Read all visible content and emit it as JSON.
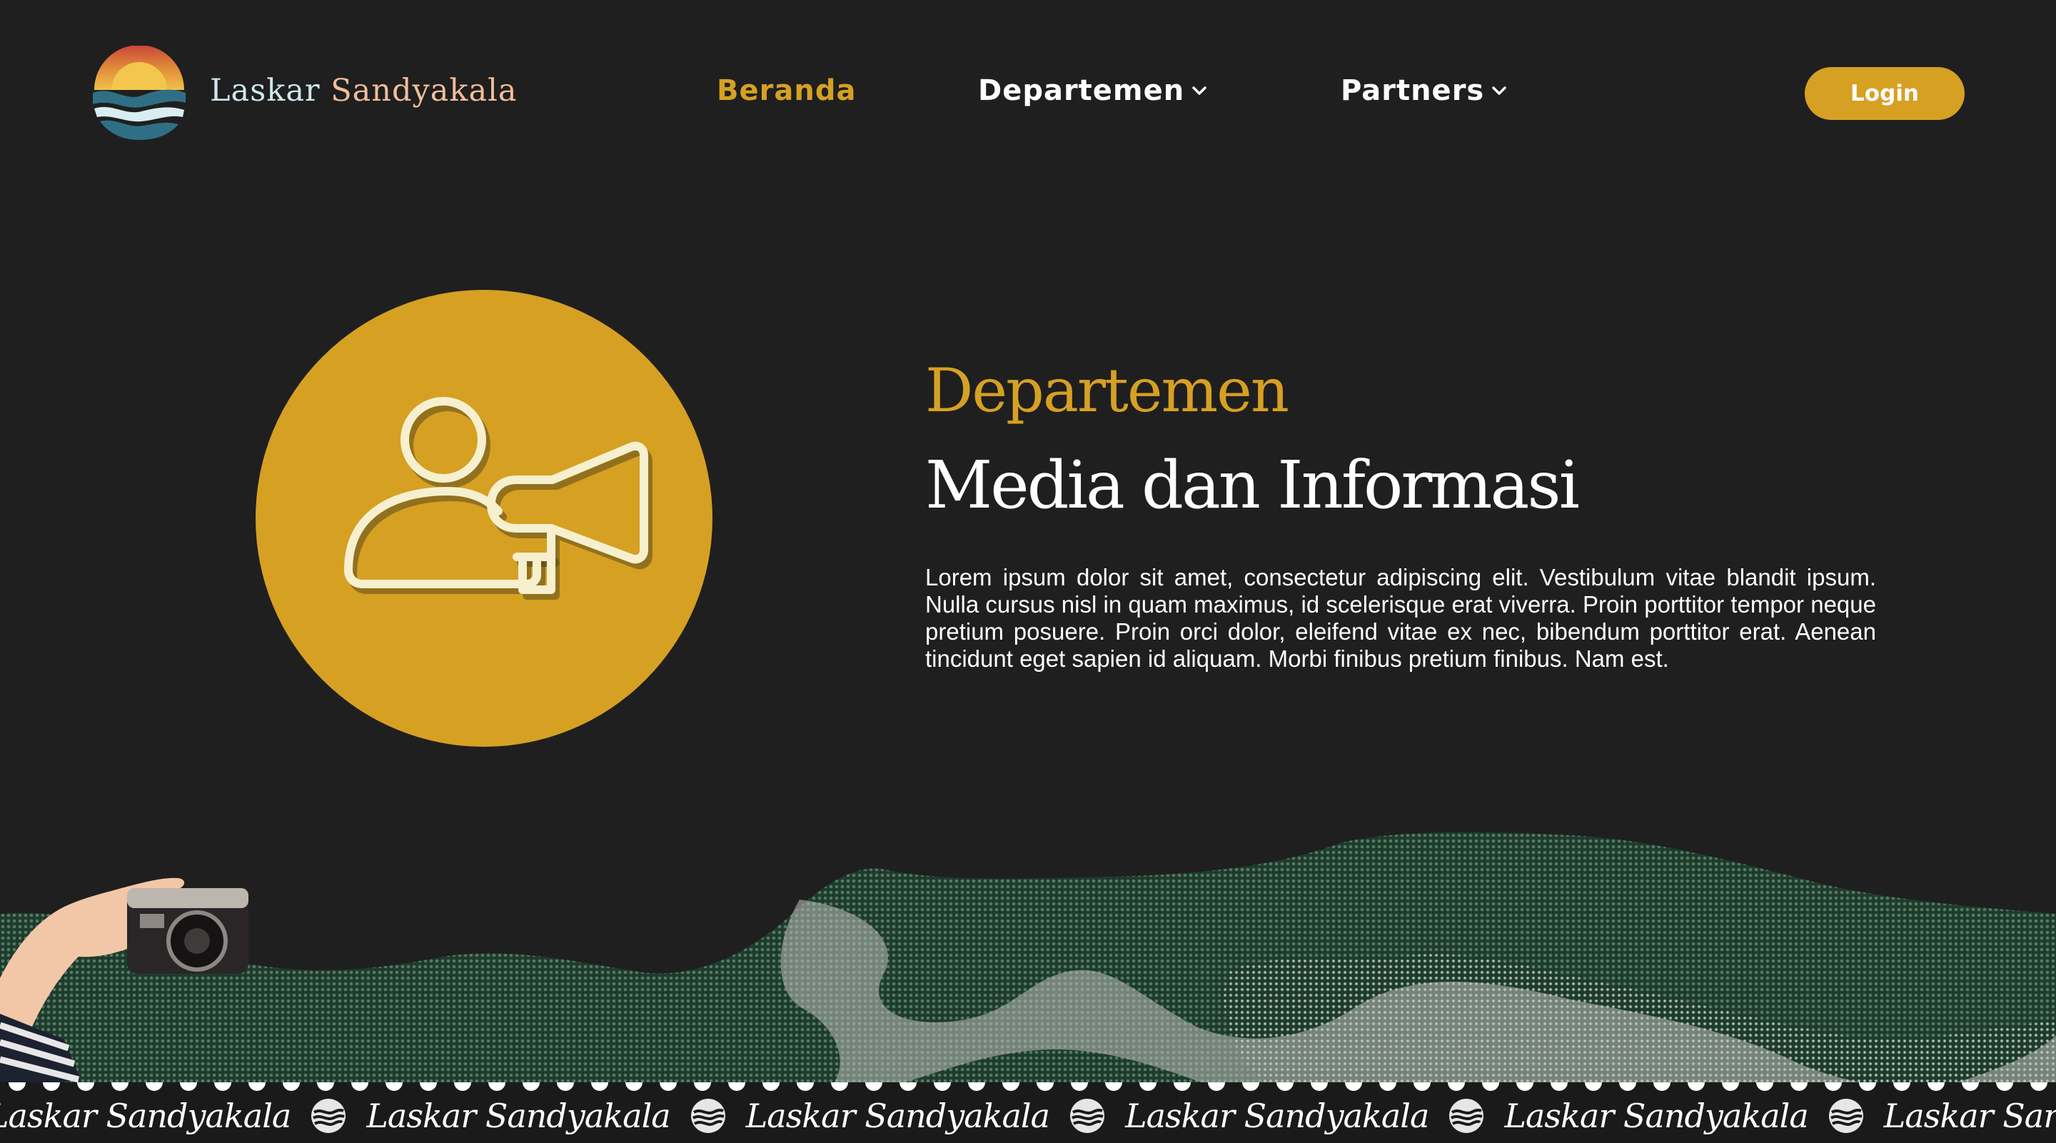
{
  "brand": {
    "name_part1": "Laskar",
    "name_part2": "Sandyakala"
  },
  "nav": {
    "items": [
      {
        "label": "Beranda",
        "active": true
      },
      {
        "label": "Departemen",
        "has_dropdown": true
      },
      {
        "label": "Partners",
        "has_dropdown": true
      }
    ],
    "login_label": "Login"
  },
  "hero": {
    "kicker": "Departemen",
    "title": "Media dan Informasi",
    "description": "Lorem ipsum dolor sit amet, consectetur adipiscing elit. Vestibulum vitae blandit ipsum. Nulla cursus nisl in quam maximus, id scelerisque erat viverra. Proin porttitor tempor neque pretium posuere. Proin orci dolor, eleifend vitae ex nec, bibendum porttitor erat. Aenean tincidunt eget sapien id aliquam. Morbi finibus pretium finibus. Nam est.",
    "icon": "user-megaphone-icon"
  },
  "ticker": {
    "text": "Laskar Sandyakala"
  },
  "colors": {
    "background": "#1f1f1f",
    "accent": "#d6a023",
    "icon_stroke": "#f6f0cf"
  }
}
